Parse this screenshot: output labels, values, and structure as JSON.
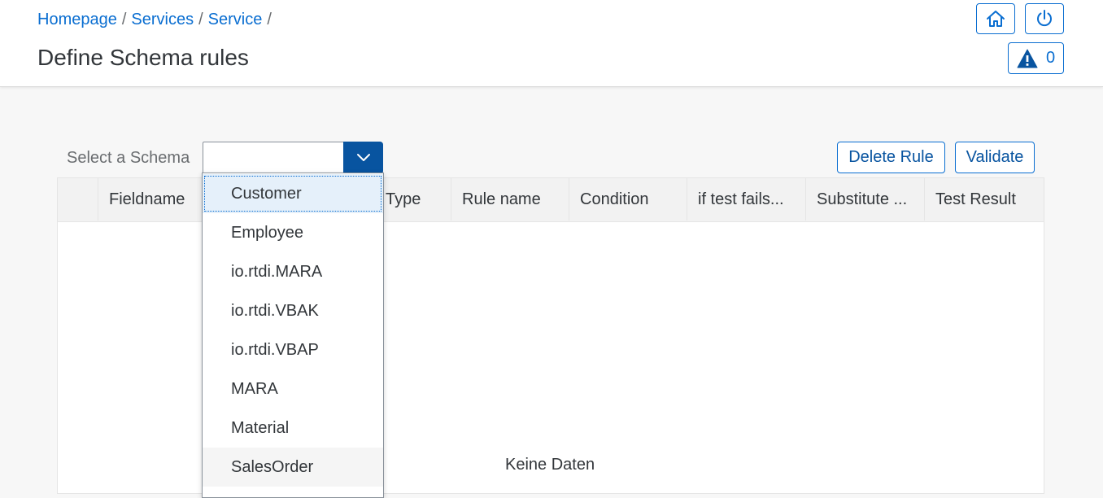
{
  "header": {
    "breadcrumbs": [
      "Homepage",
      "Services",
      "Service"
    ],
    "breadcrumb_sep": "/",
    "title": "Define Schema rules",
    "message_count": "0",
    "icons": {
      "home": "home-icon",
      "power": "power-icon",
      "warning": "warning-icon"
    }
  },
  "toolbar": {
    "schema_label": "Select a Schema",
    "schema_value": "",
    "delete_label": "Delete Rule",
    "validate_label": "Validate"
  },
  "table": {
    "columns": [
      "",
      "Fieldname",
      "Type",
      "Rule name",
      "Condition",
      "if test fails...",
      "Substitute ...",
      "Test Result"
    ],
    "no_data_text": "Keine Daten"
  },
  "dropdown": {
    "options": [
      "Customer",
      "Employee",
      "io.rtdi.MARA",
      "io.rtdi.VBAK",
      "io.rtdi.VBAP",
      "MARA",
      "Material",
      "SalesOrder"
    ],
    "focused_index": 0,
    "hover_index": 7
  },
  "colors": {
    "accent": "#0a6ed1",
    "accent_dark": "#0854a0",
    "text": "#32363a"
  }
}
